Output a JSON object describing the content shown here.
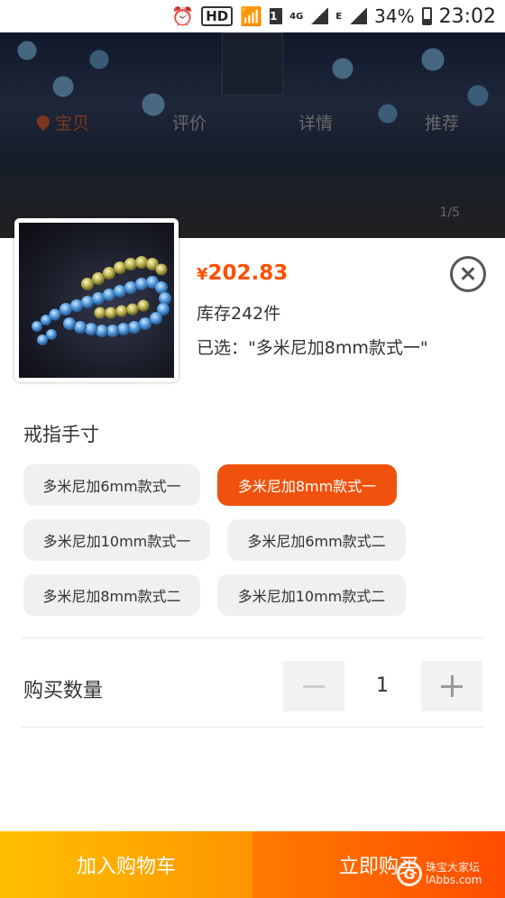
{
  "statusbar": {
    "hd": "HD",
    "sim": "1",
    "net1": "4G",
    "net2": "E",
    "battery": "34%",
    "time": "23:02"
  },
  "background_page": {
    "tabs": [
      {
        "label": "宝贝",
        "active": true
      },
      {
        "label": "评价",
        "active": false
      },
      {
        "label": "详情",
        "active": false
      },
      {
        "label": "推荐",
        "active": false
      }
    ],
    "pager": "1/5"
  },
  "sku": {
    "price_symbol": "¥",
    "price": "202.83",
    "stock": "库存242件",
    "selected": "已选：\"多米尼加8mm款式一\"",
    "group_title": "戒指手寸",
    "options": [
      {
        "label": "多米尼加6mm款式一",
        "active": false
      },
      {
        "label": "多米尼加8mm款式一",
        "active": true
      },
      {
        "label": "多米尼加10mm款式一",
        "active": false
      },
      {
        "label": "多米尼加6mm款式二",
        "active": false
      },
      {
        "label": "多米尼加8mm款式二",
        "active": false
      },
      {
        "label": "多米尼加10mm款式二",
        "active": false
      }
    ],
    "quantity_label": "购买数量",
    "quantity": "1"
  },
  "actions": {
    "add_to_cart": "加入购物车",
    "buy_now": "立即购买"
  },
  "watermark": {
    "text1": "珠宝大家坛",
    "text2": "lAbbs.com"
  },
  "colors": {
    "accent": "#ff5000",
    "active_option": "#f0520d",
    "cart_button": "#ffa500",
    "buy_button": "#ff5e00"
  }
}
